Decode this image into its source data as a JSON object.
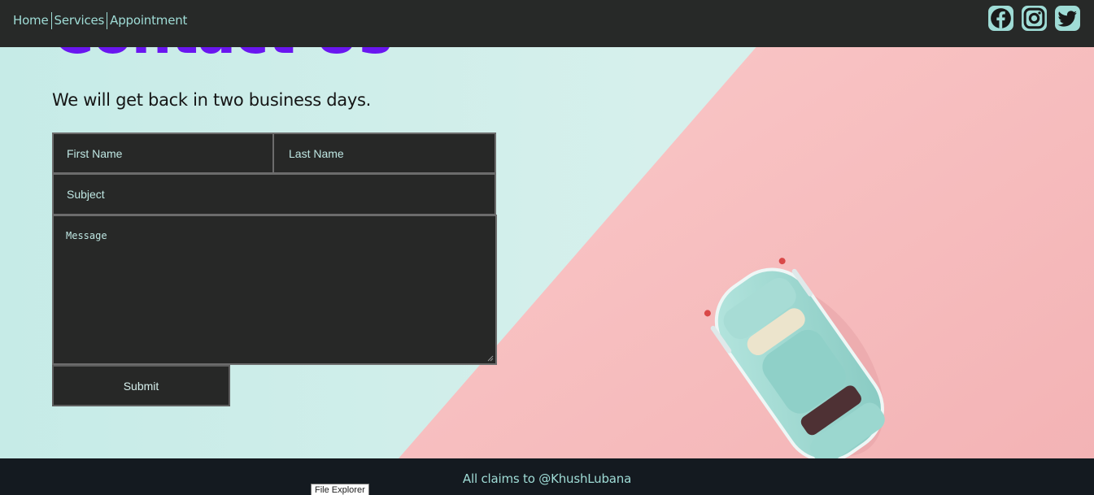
{
  "nav": {
    "links": [
      {
        "label": "Home"
      },
      {
        "label": "Services"
      },
      {
        "label": "Appointment"
      }
    ],
    "social_icons": [
      "facebook-icon",
      "instagram-icon",
      "twitter-icon"
    ]
  },
  "hero": {
    "title": "Contact Us",
    "subtitle": "We will get back in two business days."
  },
  "form": {
    "first_name_placeholder": "First Name",
    "last_name_placeholder": "Last Name",
    "subject_placeholder": "Subject",
    "message_placeholder": "Message",
    "submit_label": "Submit"
  },
  "footer": {
    "text": "All claims to @KhushLubana"
  },
  "tooltip": {
    "text": "File Explorer"
  },
  "colors": {
    "navbar_bg": "#272928",
    "nav_text": "#9fdcd6",
    "title": "#6a16f0",
    "field_bg": "#272827",
    "footer_bg": "#141a20",
    "background_mint": "#cfecea",
    "background_pink": "#f7bcbc",
    "car": "#9fd6cf"
  }
}
